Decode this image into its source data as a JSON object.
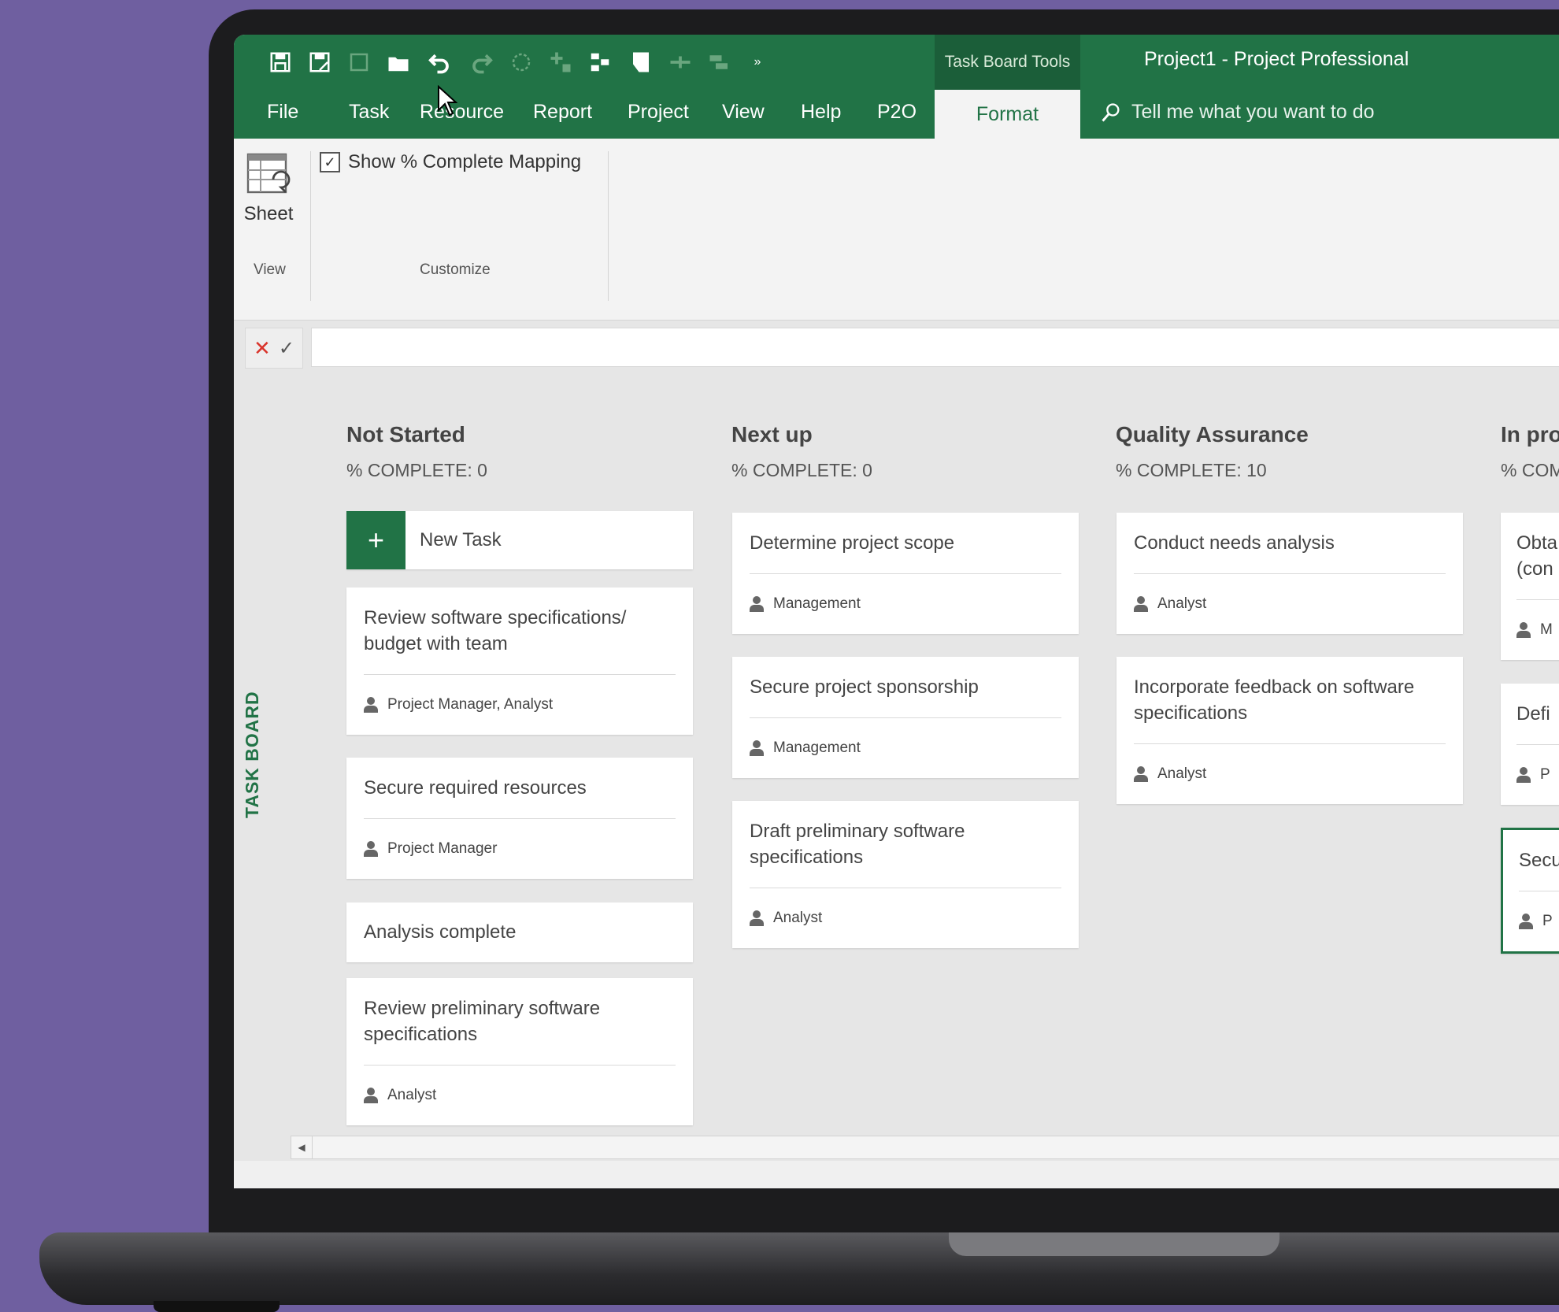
{
  "qat": {
    "icons": [
      "save-icon",
      "save-as-icon",
      "new-icon",
      "open-icon",
      "undo-icon",
      "redo-icon",
      "circle-icon",
      "sparkle-icon",
      "branch-icon",
      "page-icon",
      "link-icon",
      "table-icon",
      "more-icon"
    ]
  },
  "title": {
    "context_tab": "Task Board Tools",
    "window_title": "Project1  -  Project Professional"
  },
  "tabs": {
    "file": "File",
    "task": "Task",
    "resource": "Resource",
    "report": "Report",
    "project": "Project",
    "view": "View",
    "help": "Help",
    "p2o": "P2O",
    "format": "Format"
  },
  "search": {
    "placeholder": "Tell me what you want to do"
  },
  "ribbon": {
    "sheet_label": "Sheet",
    "show_mapping_label": "Show % Complete Mapping",
    "show_mapping_checked": true,
    "group_view": "View",
    "group_customize": "Customize"
  },
  "board": {
    "sidebar_label": "TASK BOARD",
    "new_task_label": "New Task",
    "columns": [
      {
        "title": "Not Started",
        "pct": "% COMPLETE: 0",
        "cards": [
          {
            "title": "Review software specifications/ budget with team",
            "assign": "Project Manager, Analyst"
          },
          {
            "title": "Secure required resources",
            "assign": "Project Manager"
          },
          {
            "title": "Analysis complete",
            "assign": ""
          },
          {
            "title": "Review preliminary software specifications",
            "assign": "Analyst"
          }
        ]
      },
      {
        "title": "Next up",
        "pct": "% COMPLETE: 0",
        "cards": [
          {
            "title": "Determine project scope",
            "assign": "Management"
          },
          {
            "title": "Secure project sponsorship",
            "assign": "Management"
          },
          {
            "title": "Draft preliminary software specifications",
            "assign": "Analyst"
          }
        ]
      },
      {
        "title": "Quality Assurance",
        "pct": "% COMPLETE: 10",
        "cards": [
          {
            "title": "Conduct needs analysis",
            "assign": "Analyst"
          },
          {
            "title": "Incorporate feedback on software specifications",
            "assign": "Analyst"
          }
        ]
      },
      {
        "title": "In pro",
        "pct": "% COM",
        "cards": [
          {
            "title": "Obta (con",
            "assign": "M"
          },
          {
            "title": "Defi",
            "assign": "P"
          },
          {
            "title": "Secu",
            "assign": "P"
          }
        ]
      }
    ]
  }
}
